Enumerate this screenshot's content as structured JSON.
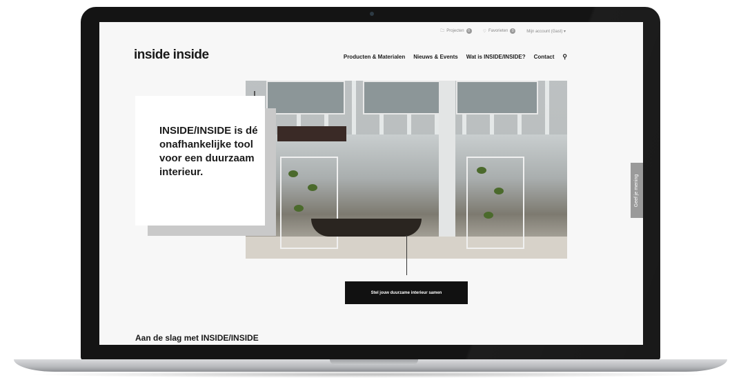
{
  "topbar": {
    "projects_label": "Projecten",
    "projects_count": "0",
    "favorites_label": "Favorieten",
    "favorites_count": "0",
    "account_label": "Mijn account (Gast) ▾"
  },
  "logo": "inside inside",
  "nav": {
    "items": [
      "Producten & Materialen",
      "Nieuws & Events",
      "Wat is INSIDE/INSIDE?",
      "Contact"
    ]
  },
  "hero": {
    "heading": "INSIDE/INSIDE is dé onafhankelijke tool voor een duurzaam interieur.",
    "cta_label": "Stel jouw duurzame interieur samen"
  },
  "feedback": {
    "label": "Geef je mening"
  },
  "section": {
    "title": "Aan de slag met INSIDE/INSIDE"
  },
  "icons": {
    "projects": "folder-icon",
    "favorites": "heart-icon",
    "search": "search-icon"
  },
  "colors": {
    "cta_bg": "#111111",
    "accent_gray": "#c9c9c9",
    "feedback_bg": "#9a9a9a"
  }
}
